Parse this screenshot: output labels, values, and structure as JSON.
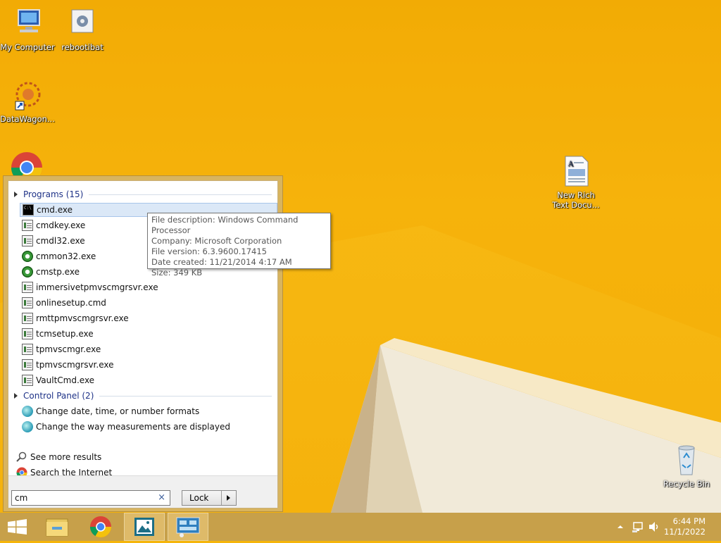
{
  "desktop": {
    "icons": [
      {
        "label": "My Computer"
      },
      {
        "label": "rebootibat"
      },
      {
        "label": "DataWagon..."
      },
      {
        "label": "New Rich Text Docu..."
      },
      {
        "label": "Recycle Bin"
      }
    ]
  },
  "start_menu": {
    "programs_header": "Programs (15)",
    "programs": [
      {
        "label": "cmd.exe",
        "icon": "cmd-icon"
      },
      {
        "label": "cmdkey.exe",
        "icon": "window-icon"
      },
      {
        "label": "cmdl32.exe",
        "icon": "phone-icon"
      },
      {
        "label": "cmmon32.exe",
        "icon": "gear-icon"
      },
      {
        "label": "cmstp.exe",
        "icon": "gear-icon"
      },
      {
        "label": "immersivetpmvscmgrsvr.exe",
        "icon": "window-icon"
      },
      {
        "label": "onlinesetup.cmd",
        "icon": "settings-icon"
      },
      {
        "label": "rmttpmvscmgrsvr.exe",
        "icon": "window-icon"
      },
      {
        "label": "tcmsetup.exe",
        "icon": "window-icon"
      },
      {
        "label": "tpmvscmgr.exe",
        "icon": "window-icon"
      },
      {
        "label": "tpmvscmgrsvr.exe",
        "icon": "window-icon"
      },
      {
        "label": "VaultCmd.exe",
        "icon": "window-icon"
      }
    ],
    "control_panel_header": "Control Panel (2)",
    "control_panel": [
      {
        "label": "Change date, time, or number formats"
      },
      {
        "label": "Change the way measurements are displayed"
      }
    ],
    "see_more": "See more results",
    "search_internet": "Search the Internet",
    "search_value": "cm",
    "clear_glyph": "×",
    "lock_label": "Lock"
  },
  "tooltip": {
    "lines": [
      "File description: Windows Command Processor",
      "Company: Microsoft Corporation",
      "File version: 6.3.9600.17415",
      "Date created: 11/21/2014 4:17 AM",
      "Size: 349 KB"
    ]
  },
  "taskbar": {
    "time": "6:44 PM",
    "date": "11/1/2022"
  }
}
